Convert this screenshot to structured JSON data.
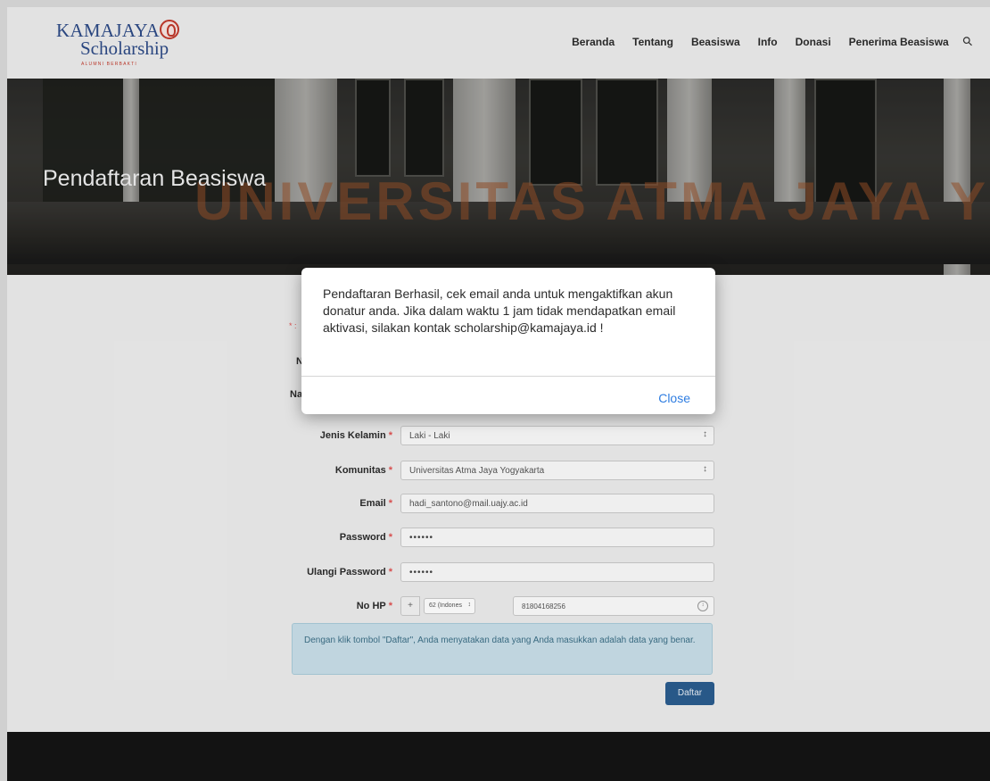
{
  "header": {
    "logo": {
      "line1": "KAMAJAYA",
      "line2": "Scholarship",
      "tagline": "ALUMNI BERBAKTI"
    },
    "nav": [
      "Beranda",
      "Tentang",
      "Beasiswa",
      "Info",
      "Donasi",
      "Penerima Beasiswa"
    ],
    "search_icon": "search-icon"
  },
  "hero": {
    "title": "Pendaftaran Beasiswa",
    "building_text": "UNIVERSITAS ATMA JAYA YOGYAKARTA"
  },
  "form": {
    "required_hint": "* :",
    "partial_labels": [
      "N",
      "Na"
    ],
    "fields": {
      "gender": {
        "label": "Jenis Kelamin",
        "value": "Laki - Laki"
      },
      "community": {
        "label": "Komunitas",
        "value": "Universitas Atma Jaya Yogyakarta"
      },
      "email": {
        "label": "Email",
        "value": "hadi_santono@mail.uajy.ac.id"
      },
      "password": {
        "label": "Password",
        "value": "••••••"
      },
      "repeat_password": {
        "label": "Ulangi Password",
        "value": "••••••"
      },
      "phone": {
        "label": "No HP",
        "prefix": "+",
        "country_code": "62 (Indones",
        "number": "81804168256"
      }
    },
    "required_mark": "*",
    "notice": "Dengan klik tombol \"Daftar\", Anda menyatakan data yang Anda masukkan adalah data yang benar.",
    "submit_label": "Daftar"
  },
  "modal": {
    "message": "Pendaftaran Berhasil, cek email anda untuk mengaktifkan akun donatur anda. Jika dalam waktu 1 jam tidak mendapatkan email aktivasi, silakan kontak scholarship@kamajaya.id !",
    "close_label": "Close"
  },
  "colors": {
    "brand_blue": "#2d4a86",
    "brand_red": "#c0392b",
    "required_red": "#e05252",
    "link_blue": "#2f7de1",
    "submit_blue": "#2a5c8e",
    "notice_bg": "#c8dee9"
  }
}
